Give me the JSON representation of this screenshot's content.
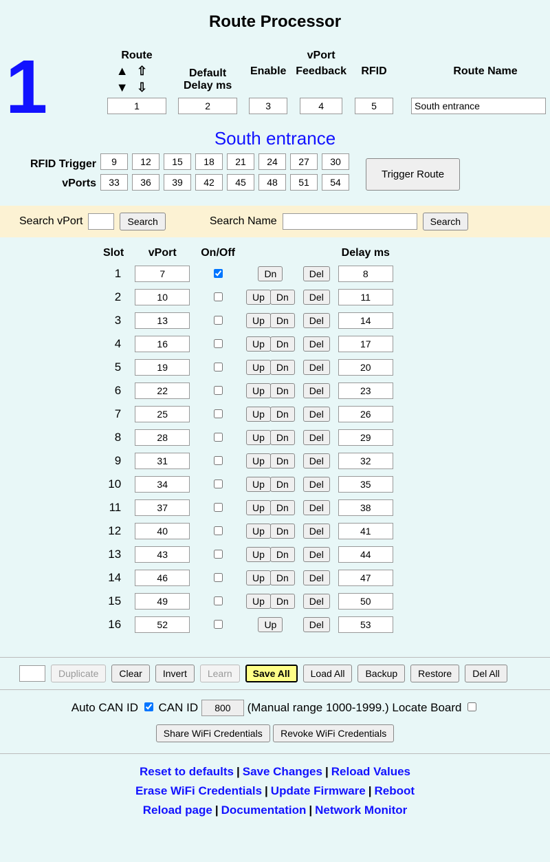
{
  "title": "Route Processor",
  "board_id": "1",
  "headers": {
    "route": "Route",
    "vport": "vPort",
    "default_delay": "Default Delay ms",
    "enable": "Enable",
    "feedback": "Feedback",
    "rfid": "RFID",
    "route_name": "Route Name"
  },
  "route": {
    "number": "1",
    "default_delay": "2",
    "enable_vport": "3",
    "feedback_vport": "4",
    "rfid_vport": "5",
    "name": "South entrance"
  },
  "route_name_display": "South entrance",
  "trigger": {
    "label_rfid": "RFID Trigger",
    "label_vports": "vPorts",
    "row1": [
      "9",
      "12",
      "15",
      "18",
      "21",
      "24",
      "27",
      "30"
    ],
    "row2": [
      "33",
      "36",
      "39",
      "42",
      "45",
      "48",
      "51",
      "54"
    ],
    "button": "Trigger Route"
  },
  "search": {
    "vport_label": "Search vPort",
    "vport_btn": "Search",
    "name_label": "Search Name",
    "name_btn": "Search"
  },
  "slot_headers": {
    "slot": "Slot",
    "vport": "vPort",
    "onoff": "On/Off",
    "delay": "Delay ms"
  },
  "btn_labels": {
    "up": "Up",
    "dn": "Dn",
    "del": "Del"
  },
  "slots": [
    {
      "n": "1",
      "vport": "7",
      "on": true,
      "up": false,
      "dn": true,
      "delay": "8"
    },
    {
      "n": "2",
      "vport": "10",
      "on": false,
      "up": true,
      "dn": true,
      "delay": "11"
    },
    {
      "n": "3",
      "vport": "13",
      "on": false,
      "up": true,
      "dn": true,
      "delay": "14"
    },
    {
      "n": "4",
      "vport": "16",
      "on": false,
      "up": true,
      "dn": true,
      "delay": "17"
    },
    {
      "n": "5",
      "vport": "19",
      "on": false,
      "up": true,
      "dn": true,
      "delay": "20"
    },
    {
      "n": "6",
      "vport": "22",
      "on": false,
      "up": true,
      "dn": true,
      "delay": "23"
    },
    {
      "n": "7",
      "vport": "25",
      "on": false,
      "up": true,
      "dn": true,
      "delay": "26"
    },
    {
      "n": "8",
      "vport": "28",
      "on": false,
      "up": true,
      "dn": true,
      "delay": "29"
    },
    {
      "n": "9",
      "vport": "31",
      "on": false,
      "up": true,
      "dn": true,
      "delay": "32"
    },
    {
      "n": "10",
      "vport": "34",
      "on": false,
      "up": true,
      "dn": true,
      "delay": "35"
    },
    {
      "n": "11",
      "vport": "37",
      "on": false,
      "up": true,
      "dn": true,
      "delay": "38"
    },
    {
      "n": "12",
      "vport": "40",
      "on": false,
      "up": true,
      "dn": true,
      "delay": "41"
    },
    {
      "n": "13",
      "vport": "43",
      "on": false,
      "up": true,
      "dn": true,
      "delay": "44"
    },
    {
      "n": "14",
      "vport": "46",
      "on": false,
      "up": true,
      "dn": true,
      "delay": "47"
    },
    {
      "n": "15",
      "vport": "49",
      "on": false,
      "up": true,
      "dn": true,
      "delay": "50"
    },
    {
      "n": "16",
      "vport": "52",
      "on": false,
      "up": true,
      "dn": false,
      "delay": "53"
    }
  ],
  "toolbar": {
    "duplicate": "Duplicate",
    "clear": "Clear",
    "invert": "Invert",
    "learn": "Learn",
    "save_all": "Save All",
    "load_all": "Load All",
    "backup": "Backup",
    "restore": "Restore",
    "del_all": "Del All"
  },
  "can": {
    "auto_label": "Auto CAN ID",
    "auto_checked": true,
    "id_label": "CAN ID",
    "id_value": "800",
    "manual_note": "(Manual range 1000-1999.)",
    "locate_label": "Locate Board",
    "locate_checked": false
  },
  "wifi": {
    "share": "Share WiFi Credentials",
    "revoke": "Revoke WiFi Credentials"
  },
  "links": {
    "row1": [
      "Reset to defaults",
      "Save Changes",
      "Reload Values"
    ],
    "row2": [
      "Erase WiFi Credentials",
      "Update Firmware",
      "Reboot"
    ],
    "row3": [
      "Reload page",
      "Documentation",
      "Network Monitor"
    ]
  }
}
